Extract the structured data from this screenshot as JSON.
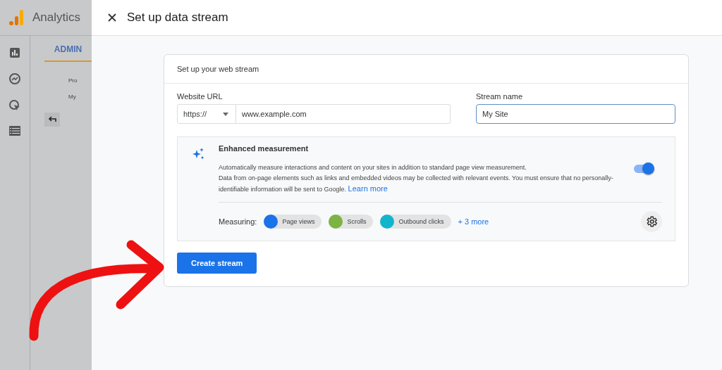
{
  "app": {
    "name": "Analytics",
    "tab": "ADMIN",
    "background_texts": [
      "Pro",
      "My"
    ]
  },
  "panel": {
    "title": "Set up data stream"
  },
  "card": {
    "heading": "Set up your web stream",
    "url": {
      "label": "Website URL",
      "protocol": "https://",
      "value": "www.example.com"
    },
    "stream_name": {
      "label": "Stream name",
      "value": "My Site"
    },
    "enhanced": {
      "title": "Enhanced measurement",
      "on": true,
      "line1": "Automatically measure interactions and content on your sites in addition to standard page view measurement.",
      "line2": "Data from on-page elements such as links and embedded videos may be collected with relevant events. You must ensure that no personally-identifiable information will be sent to Google.",
      "link": "Learn more",
      "measuring_label": "Measuring:",
      "chips": [
        {
          "label": "Page views",
          "color": "#1a73e8"
        },
        {
          "label": "Scrolls",
          "color": "#7cb342"
        },
        {
          "label": "Outbound clicks",
          "color": "#12b5cb"
        }
      ],
      "more": "+ 3 more"
    },
    "button": "Create stream"
  }
}
